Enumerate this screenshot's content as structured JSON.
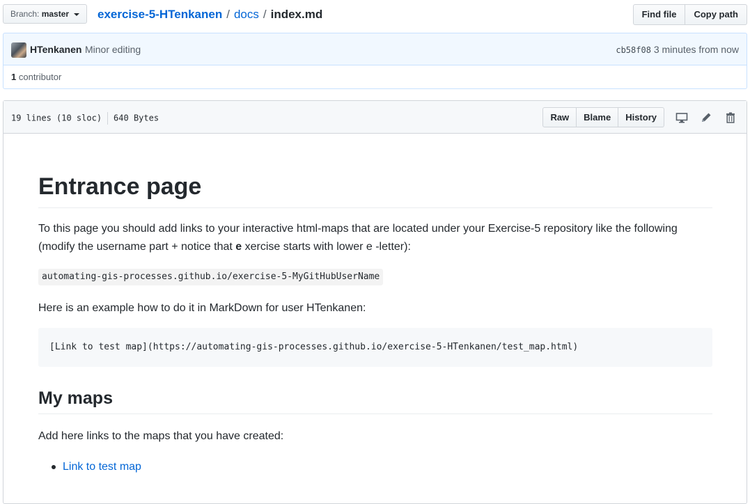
{
  "branch": {
    "label": "Branch:",
    "value": "master"
  },
  "breadcrumb": {
    "repo": "exercise-5-HTenkanen",
    "sep1": "/",
    "dir": "docs",
    "sep2": "/",
    "file": "index.md"
  },
  "actions": {
    "find_file": "Find file",
    "copy_path": "Copy path"
  },
  "commit": {
    "author": "HTenkanen",
    "message": "Minor editing",
    "sha": "cb58f08",
    "time": "3 minutes from now"
  },
  "contributors": {
    "count": "1",
    "label": "contributor"
  },
  "file": {
    "lines": "19 lines (10 sloc)",
    "size": "640 Bytes",
    "raw": "Raw",
    "blame": "Blame",
    "history": "History",
    "icons": [
      "desktop-icon",
      "pencil-icon",
      "trash-icon"
    ]
  },
  "markdown": {
    "h1": "Entrance page",
    "p1_before": "To this page you should add links to your interactive html-maps that are located under your Exercise-5 repository like the following (modify the username part + notice that ",
    "p1_bold": "e",
    "p1_after": " xercise starts with lower e -letter):",
    "inline_code": "automating-gis-processes.github.io/exercise-5-MyGitHubUserName",
    "p2": "Here is an example how to do it in MarkDown for user HTenkanen:",
    "code_block": "[Link to test map](https://automating-gis-processes.github.io/exercise-5-HTenkanen/test_map.html)",
    "h2": "My maps",
    "p3": "Add here links to the maps that you have created:",
    "list": [
      "Link to test map"
    ]
  },
  "colors": {
    "link": "#0366d6",
    "commit_bg": "#f1f8ff",
    "header_bg": "#f6f8fa"
  }
}
